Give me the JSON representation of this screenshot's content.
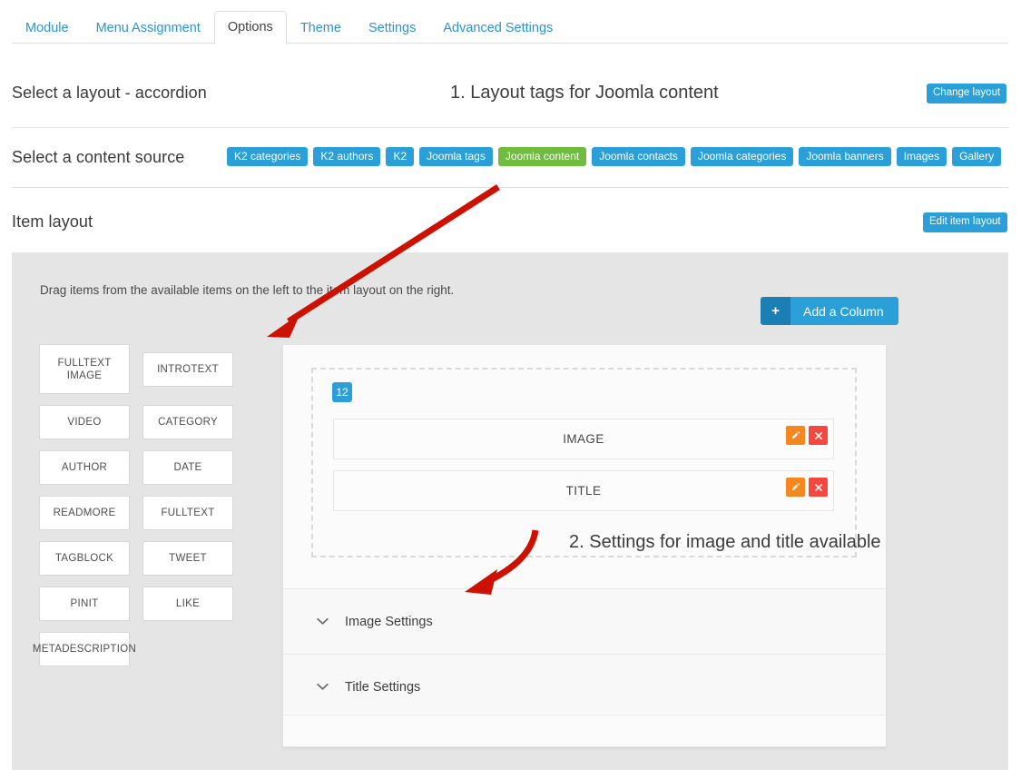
{
  "tabs": [
    {
      "label": "Module",
      "active": false
    },
    {
      "label": "Menu Assignment",
      "active": false
    },
    {
      "label": "Options",
      "active": true
    },
    {
      "label": "Theme",
      "active": false
    },
    {
      "label": "Settings",
      "active": false
    },
    {
      "label": "Advanced Settings",
      "active": false
    }
  ],
  "layout_section": {
    "title": "Select a layout - accordion",
    "change_button": "Change layout"
  },
  "source_section": {
    "title": "Select a content source",
    "sources": [
      {
        "label": "K2 categories",
        "selected": false
      },
      {
        "label": "K2 authors",
        "selected": false
      },
      {
        "label": "K2",
        "selected": false
      },
      {
        "label": "Joomla tags",
        "selected": false
      },
      {
        "label": "Joomla content",
        "selected": true
      },
      {
        "label": "Joomla contacts",
        "selected": false
      },
      {
        "label": "Joomla categories",
        "selected": false
      },
      {
        "label": "Joomla banners",
        "selected": false
      },
      {
        "label": "Images",
        "selected": false
      },
      {
        "label": "Gallery",
        "selected": false
      }
    ]
  },
  "item_layout_section": {
    "title": "Item layout",
    "edit_button": "Edit item layout"
  },
  "builder": {
    "drag_hint": "Drag items from the available items on the left to the item layout on the right.",
    "add_column_label": "Add a Column",
    "add_column_icon": "plus-icon",
    "available_items": [
      {
        "label": "FULLTEXT IMAGE"
      },
      {
        "label": "INTROTEXT"
      },
      {
        "label": "VIDEO"
      },
      {
        "label": "CATEGORY"
      },
      {
        "label": "AUTHOR"
      },
      {
        "label": "DATE"
      },
      {
        "label": "READMORE"
      },
      {
        "label": "FULLTEXT"
      },
      {
        "label": "TAGBLOCK"
      },
      {
        "label": "TWEET"
      },
      {
        "label": "PINIT"
      },
      {
        "label": "LIKE"
      },
      {
        "label": "METADESCRIPTION"
      }
    ],
    "column": {
      "width_badge": "12",
      "rows": [
        {
          "label": "IMAGE",
          "edit_icon": "pencil-icon",
          "delete_icon": "x-icon"
        },
        {
          "label": "TITLE",
          "edit_icon": "pencil-icon",
          "delete_icon": "x-icon"
        }
      ]
    },
    "settings_accordions": [
      {
        "label": "Image Settings",
        "icon": "chevron-down-icon"
      },
      {
        "label": "Title Settings",
        "icon": "chevron-down-icon"
      }
    ]
  },
  "annotations": [
    {
      "text": "1. Layout tags for Joomla content"
    },
    {
      "text": "2. Settings for image and title available"
    }
  ],
  "colors": {
    "accent_blue": "#2a9fd8",
    "selected_green": "#6fbc3f",
    "edit_orange": "#f6871f",
    "delete_red": "#f5473d",
    "annotation_red": "#cc1100",
    "panel_gray": "#e5e5e5"
  }
}
